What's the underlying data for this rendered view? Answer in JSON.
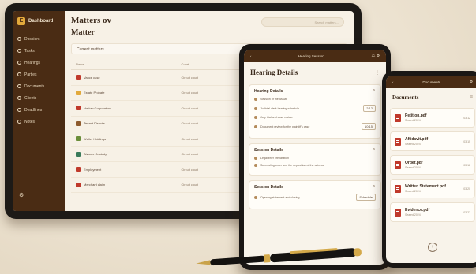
{
  "tablet": {
    "brand": {
      "logo_letter": "E",
      "name": "Dashboard"
    },
    "nav": [
      "Dossiers",
      "Tasks",
      "Hearings",
      "Parties",
      "Documents",
      "Clients",
      "Deadlines",
      "Notes"
    ],
    "title": "Matters ov",
    "subtitle": "Matter",
    "search_placeholder": "Search matters...",
    "filter_label": "Current matters",
    "table": {
      "headers": [
        "Name",
        "Court",
        "Due date",
        "Stage"
      ],
      "rows": [
        {
          "name": "Vance case",
          "court": "Circuit court",
          "due": "Oct 14, 2024",
          "icon_color": "#c0392b"
        },
        {
          "name": "Estate Probate",
          "court": "Circuit court",
          "due": "Oct 18, 2024",
          "icon_color": "#e2a93b"
        },
        {
          "name": "Harlow Corporation",
          "court": "Circuit court",
          "due": "Oct 22, 2024",
          "icon_color": "#c0392b"
        },
        {
          "name": "Tenant Dispute",
          "court": "Circuit court",
          "due": "Oct 25, 2024",
          "icon_color": "#8e5b2e"
        },
        {
          "name": "Weller Holdings",
          "court": "Circuit court",
          "due": "Oct 28, 2024",
          "icon_color": "#6b8e3a"
        },
        {
          "name": "Alvarez Custody",
          "court": "Circuit court",
          "due": "Nov 02, 2024",
          "icon_color": "#3a7a5a"
        },
        {
          "name": "Employment",
          "court": "Circuit court",
          "due": "Nov 05, 2024",
          "icon_color": "#c0392b"
        },
        {
          "name": "Merchant claim",
          "court": "Circuit court",
          "due": "Nov 09, 2024",
          "icon_color": "#c0392b"
        }
      ]
    }
  },
  "phone": {
    "topbar_title": "Hearing Session",
    "title": "Hearing Details",
    "cards": [
      {
        "heading": "Hearing Details",
        "lines": [
          {
            "text": "Session of the Assize",
            "tag": ""
          },
          {
            "text": "Judicial clerk hearing schedule",
            "tag": "2:12"
          },
          {
            "text": "Jury trial and case review",
            "tag": ""
          },
          {
            "text": "Document review for the plaintiff's case",
            "tag": "10:15"
          }
        ]
      },
      {
        "heading": "Session Details",
        "lines": [
          {
            "text": "Legal brief preparation",
            "tag": ""
          },
          {
            "text": "Scheduling order and the deposition of the witness",
            "tag": ""
          }
        ]
      },
      {
        "heading": "Session Details",
        "lines": [
          {
            "text": "Opening statement and closing",
            "tag": "Schedule"
          }
        ]
      }
    ]
  },
  "phone2": {
    "topbar_title": "Documents",
    "title": "Documents",
    "docs": [
      {
        "name": "Petition.pdf",
        "meta": "Sealed 2024",
        "size": "03:12"
      },
      {
        "name": "Affidavit.pdf",
        "meta": "Sealed 2024",
        "size": "03:15"
      },
      {
        "name": "Order.pdf",
        "meta": "Sealed 2024",
        "size": "03:18"
      },
      {
        "name": "Written Statement.pdf",
        "meta": "Sealed 2024",
        "size": "03:20"
      },
      {
        "name": "Evidence.pdf",
        "meta": "Sealed 2024",
        "size": "03:22"
      }
    ]
  }
}
